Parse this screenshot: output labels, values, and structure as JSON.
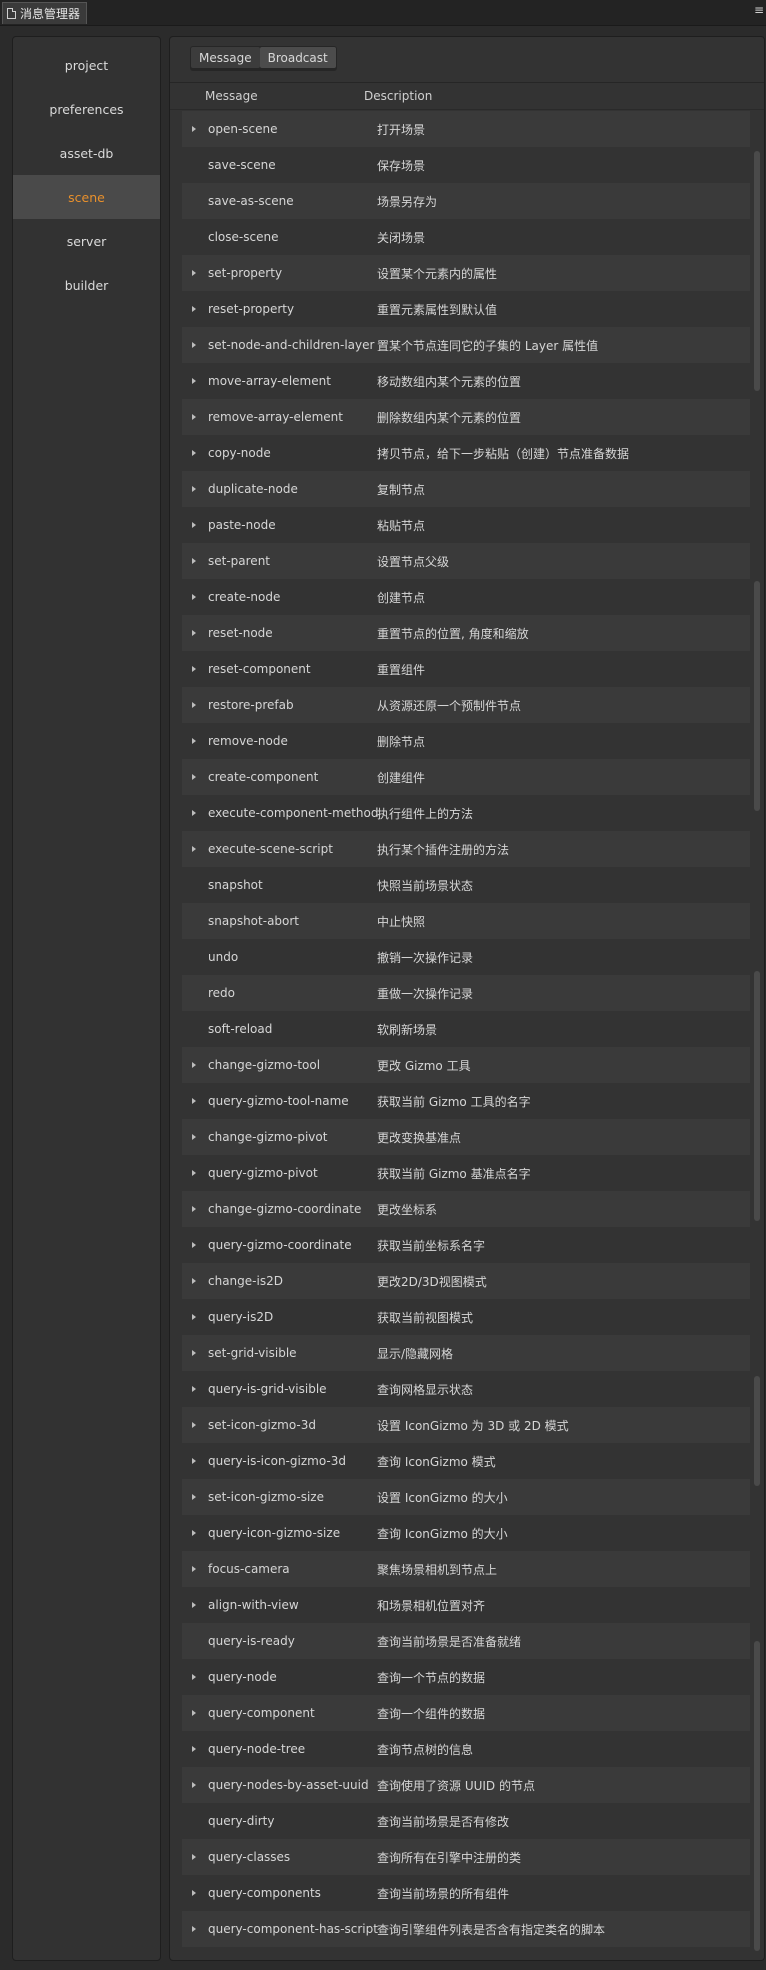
{
  "window": {
    "tab_title": "消息管理器",
    "menu_icon": "hamburger-menu-icon"
  },
  "sidebar": {
    "items": [
      {
        "label": "project",
        "active": false
      },
      {
        "label": "preferences",
        "active": false
      },
      {
        "label": "asset-db",
        "active": false
      },
      {
        "label": "scene",
        "active": true
      },
      {
        "label": "server",
        "active": false
      },
      {
        "label": "builder",
        "active": false
      }
    ]
  },
  "tabs": [
    {
      "label": "Message",
      "active": true
    },
    {
      "label": "Broadcast",
      "active": false
    }
  ],
  "columns": {
    "message": "Message",
    "description": "Description"
  },
  "colors": {
    "accent": "#e8902c",
    "background": "#2b2b2b",
    "panel": "#333333"
  },
  "rows": [
    {
      "message": "open-scene",
      "description": "打开场景",
      "expandable": true
    },
    {
      "message": "save-scene",
      "description": "保存场景",
      "expandable": false
    },
    {
      "message": "save-as-scene",
      "description": "场景另存为",
      "expandable": false
    },
    {
      "message": "close-scene",
      "description": "关闭场景",
      "expandable": false
    },
    {
      "message": "set-property",
      "description": "设置某个元素内的属性",
      "expandable": true
    },
    {
      "message": "reset-property",
      "description": "重置元素属性到默认值",
      "expandable": true
    },
    {
      "message": "set-node-and-children-layer",
      "description": "置某个节点连同它的子集的 Layer 属性值",
      "expandable": true
    },
    {
      "message": "move-array-element",
      "description": "移动数组内某个元素的位置",
      "expandable": true
    },
    {
      "message": "remove-array-element",
      "description": "删除数组内某个元素的位置",
      "expandable": true
    },
    {
      "message": "copy-node",
      "description": "拷贝节点，给下一步粘贴（创建）节点准备数据",
      "expandable": true
    },
    {
      "message": "duplicate-node",
      "description": "复制节点",
      "expandable": true
    },
    {
      "message": "paste-node",
      "description": "粘贴节点",
      "expandable": true
    },
    {
      "message": "set-parent",
      "description": "设置节点父级",
      "expandable": true
    },
    {
      "message": "create-node",
      "description": "创建节点",
      "expandable": true
    },
    {
      "message": "reset-node",
      "description": "重置节点的位置, 角度和缩放",
      "expandable": true
    },
    {
      "message": "reset-component",
      "description": "重置组件",
      "expandable": true
    },
    {
      "message": "restore-prefab",
      "description": "从资源还原一个预制件节点",
      "expandable": true
    },
    {
      "message": "remove-node",
      "description": "删除节点",
      "expandable": true
    },
    {
      "message": "create-component",
      "description": "创建组件",
      "expandable": true
    },
    {
      "message": "execute-component-method",
      "description": "执行组件上的方法",
      "expandable": true
    },
    {
      "message": "execute-scene-script",
      "description": "执行某个插件注册的方法",
      "expandable": true
    },
    {
      "message": "snapshot",
      "description": "快照当前场景状态",
      "expandable": false
    },
    {
      "message": "snapshot-abort",
      "description": "中止快照",
      "expandable": false
    },
    {
      "message": "undo",
      "description": "撤销一次操作记录",
      "expandable": false
    },
    {
      "message": "redo",
      "description": "重做一次操作记录",
      "expandable": false
    },
    {
      "message": "soft-reload",
      "description": "软刷新场景",
      "expandable": false
    },
    {
      "message": "change-gizmo-tool",
      "description": "更改 Gizmo 工具",
      "expandable": true
    },
    {
      "message": "query-gizmo-tool-name",
      "description": "获取当前 Gizmo 工具的名字",
      "expandable": true
    },
    {
      "message": "change-gizmo-pivot",
      "description": "更改变换基准点",
      "expandable": true
    },
    {
      "message": "query-gizmo-pivot",
      "description": "获取当前 Gizmo 基准点名字",
      "expandable": true
    },
    {
      "message": "change-gizmo-coordinate",
      "description": "更改坐标系",
      "expandable": true
    },
    {
      "message": "query-gizmo-coordinate",
      "description": "获取当前坐标系名字",
      "expandable": true
    },
    {
      "message": "change-is2D",
      "description": "更改2D/3D视图模式",
      "expandable": true
    },
    {
      "message": "query-is2D",
      "description": "获取当前视图模式",
      "expandable": true
    },
    {
      "message": "set-grid-visible",
      "description": "显示/隐藏网格",
      "expandable": true
    },
    {
      "message": "query-is-grid-visible",
      "description": "查询网格显示状态",
      "expandable": true
    },
    {
      "message": "set-icon-gizmo-3d",
      "description": "设置 IconGizmo 为 3D 或 2D 模式",
      "expandable": true
    },
    {
      "message": "query-is-icon-gizmo-3d",
      "description": "查询 IconGizmo 模式",
      "expandable": true
    },
    {
      "message": "set-icon-gizmo-size",
      "description": "设置 IconGizmo 的大小",
      "expandable": true
    },
    {
      "message": "query-icon-gizmo-size",
      "description": "查询 IconGizmo 的大小",
      "expandable": true
    },
    {
      "message": "focus-camera",
      "description": "聚焦场景相机到节点上",
      "expandable": true
    },
    {
      "message": "align-with-view",
      "description": "和场景相机位置对齐",
      "expandable": true
    },
    {
      "message": "query-is-ready",
      "description": "查询当前场景是否准备就绪",
      "expandable": false
    },
    {
      "message": "query-node",
      "description": "查询一个节点的数据",
      "expandable": true
    },
    {
      "message": "query-component",
      "description": "查询一个组件的数据",
      "expandable": true
    },
    {
      "message": "query-node-tree",
      "description": "查询节点树的信息",
      "expandable": true
    },
    {
      "message": "query-nodes-by-asset-uuid",
      "description": "查询使用了资源 UUID 的节点",
      "expandable": true
    },
    {
      "message": "query-dirty",
      "description": "查询当前场景是否有修改",
      "expandable": false
    },
    {
      "message": "query-classes",
      "description": "查询所有在引擎中注册的类",
      "expandable": true
    },
    {
      "message": "query-components",
      "description": "查询当前场景的所有组件",
      "expandable": true
    },
    {
      "message": "query-component-has-script",
      "description": "查询引擎组件列表是否含有指定类名的脚本",
      "expandable": true
    }
  ]
}
